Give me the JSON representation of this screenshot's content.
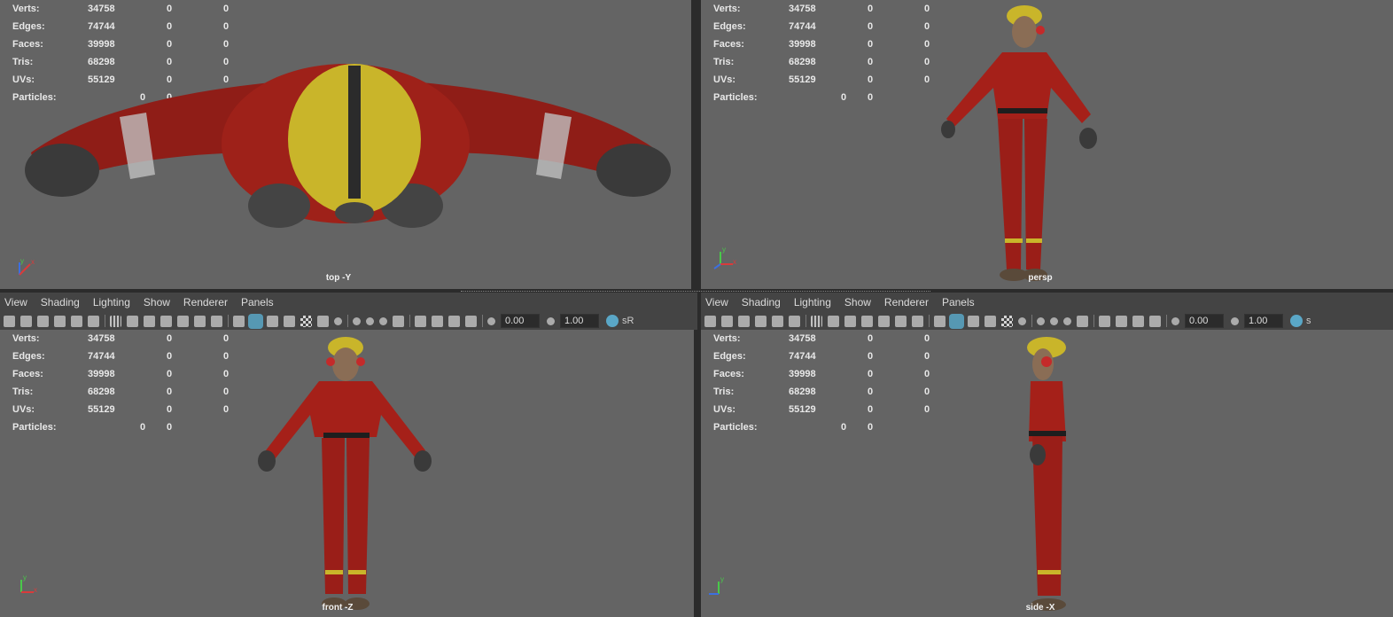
{
  "stats": {
    "labels": {
      "verts": "Verts:",
      "edges": "Edges:",
      "faces": "Faces:",
      "tris": "Tris:",
      "uvs": "UVs:",
      "particles": "Particles:"
    },
    "values": {
      "verts": [
        "34758",
        "0",
        "0"
      ],
      "edges": [
        "74744",
        "0",
        "0"
      ],
      "faces": [
        "39998",
        "0",
        "0"
      ],
      "tris": [
        "68298",
        "0",
        "0"
      ],
      "uvs": [
        "55129",
        "0",
        "0"
      ],
      "particles": [
        "0",
        "0"
      ]
    }
  },
  "viewports": {
    "top_left": {
      "camera": "top -Y"
    },
    "top_right": {
      "camera": "persp"
    },
    "bottom_left": {
      "camera": "front -Z"
    },
    "bottom_right": {
      "camera": "side -X"
    }
  },
  "axis": {
    "x": "x",
    "y": "y",
    "x_color": "#d93b3b",
    "y_color": "#49c84a",
    "z_color": "#3c6fe0"
  },
  "panel_menu": [
    "View",
    "Shading",
    "Lighting",
    "Show",
    "Renderer",
    "Panels"
  ],
  "toolbar": {
    "exposure": "0.00",
    "gamma": "1.00",
    "color_mgmt_left": "sR",
    "color_mgmt_right": "s"
  },
  "colors": {
    "viewport_bg": "#646464",
    "suit_red": "#a52019",
    "helmet_yellow": "#c9b52a",
    "accent_blue": "#5aa7c7"
  }
}
